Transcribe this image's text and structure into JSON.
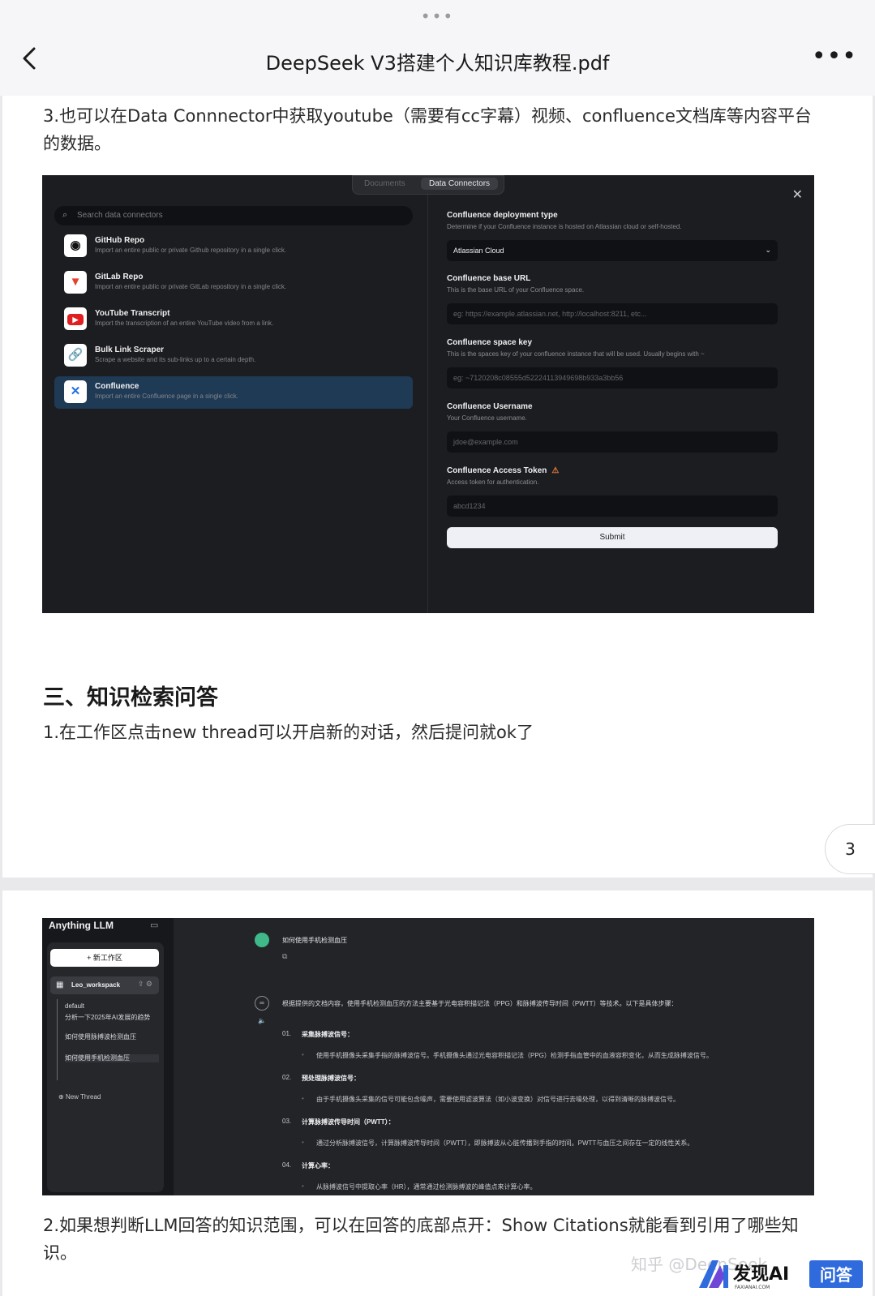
{
  "viewer": {
    "handle": "•••",
    "title": "DeepSeek V3搭建个人知识库教程.pdf",
    "more": "•••",
    "page_number": "3"
  },
  "page1": {
    "para1": "3.也可以在Data Connnector中获取youtube（需要有cc字幕）视频、confluence文档库等内容平台的数据。",
    "heading": "三、知识检索问答",
    "para2": "1.在工作区点击new thread可以开启新的对话，然后提问就ok了"
  },
  "connectors_modal": {
    "tabs": [
      "Documents",
      "Data Connectors"
    ],
    "active_tab": "Data Connectors",
    "search_placeholder": "Search data connectors",
    "connectors": [
      {
        "name": "GitHub Repo",
        "desc": "Import an entire public or private Github repository in a single click.",
        "icon": "github-icon"
      },
      {
        "name": "GitLab Repo",
        "desc": "Import an entire public or private GitLab repository in a single click.",
        "icon": "gitlab-icon"
      },
      {
        "name": "YouTube Transcript",
        "desc": "Import the transcription of an entire YouTube video from a link.",
        "icon": "youtube-icon"
      },
      {
        "name": "Bulk Link Scraper",
        "desc": "Scrape a website and its sub-links up to a certain depth.",
        "icon": "link-icon"
      },
      {
        "name": "Confluence",
        "desc": "Import an entire Confluence page in a single click.",
        "icon": "confluence-icon"
      }
    ],
    "selected_index": 4,
    "form": {
      "deploy_label": "Confluence deployment type",
      "deploy_sub": "Determine if your Confluence instance is hosted on Atlassian cloud or self-hosted.",
      "deploy_value": "Atlassian Cloud",
      "url_label": "Confluence base URL",
      "url_sub": "This is the base URL of your Confluence space.",
      "url_placeholder": "eg: https://example.atlassian.net, http://localhost:8211, etc...",
      "key_label": "Confluence space key",
      "key_sub": "This is the spaces key of your confluence instance that will be used. Usually begins with ~",
      "key_placeholder": "eg: ~7120208c08555d52224113949698b933a3bb56",
      "user_label": "Confluence Username",
      "user_sub": "Your Confluence username.",
      "user_placeholder": "jdoe@example.com",
      "token_label": "Confluence Access Token",
      "token_sub": "Access token for authentication.",
      "token_placeholder": "abcd1234",
      "submit": "Submit"
    }
  },
  "anything_llm": {
    "brand": "Anything LLM",
    "new_workspace": "+ 新工作区",
    "workspace": "Leo_workspack",
    "threads": [
      "default",
      "分析一下2025年AI发展的趋势",
      "如何使用脉搏波检测血压",
      "如何使用手机检测血压"
    ],
    "new_thread": "New Thread",
    "question": "如何使用手机检测血压",
    "intro": "根据提供的文档内容，使用手机检测血压的方法主要基于光电容积描记法（PPG）和脉搏波传导时间（PWTT）等技术。以下是具体步骤：",
    "steps": [
      {
        "n": "01.",
        "title": "采集脉搏波信号：",
        "desc": "使用手机摄像头采集手指的脉搏波信号。手机摄像头通过光电容积描记法（PPG）检测手指血管中的血液容积变化，从而生成脉搏波信号。"
      },
      {
        "n": "02.",
        "title": "预处理脉搏波信号：",
        "desc": "由于手机摄像头采集的信号可能包含噪声，需要使用滤波算法（如小波变换）对信号进行去噪处理，以得到清晰的脉搏波信号。"
      },
      {
        "n": "03.",
        "title": "计算脉搏波传导时间（PWTT）：",
        "desc": "通过分析脉搏波信号，计算脉搏波传导时间（PWTT），即脉搏波从心脏传播到手指的时间。PWTT与血压之间存在一定的线性关系。"
      },
      {
        "n": "04.",
        "title": "计算心率：",
        "desc": "从脉搏波信号中提取心率（HR），通常通过检测脉搏波的峰值点来计算心率。"
      }
    ]
  },
  "page2": {
    "para": "2.如果想判断LLM回答的知识范围，可以在回答的底部点开：Show Citations就能看到引用了哪些知识。"
  },
  "watermark": {
    "zhihu": "知乎 @DeepSeek",
    "brand": "发现AI",
    "brand_sub": "FAXIANAI.COM",
    "badge": "问答"
  }
}
